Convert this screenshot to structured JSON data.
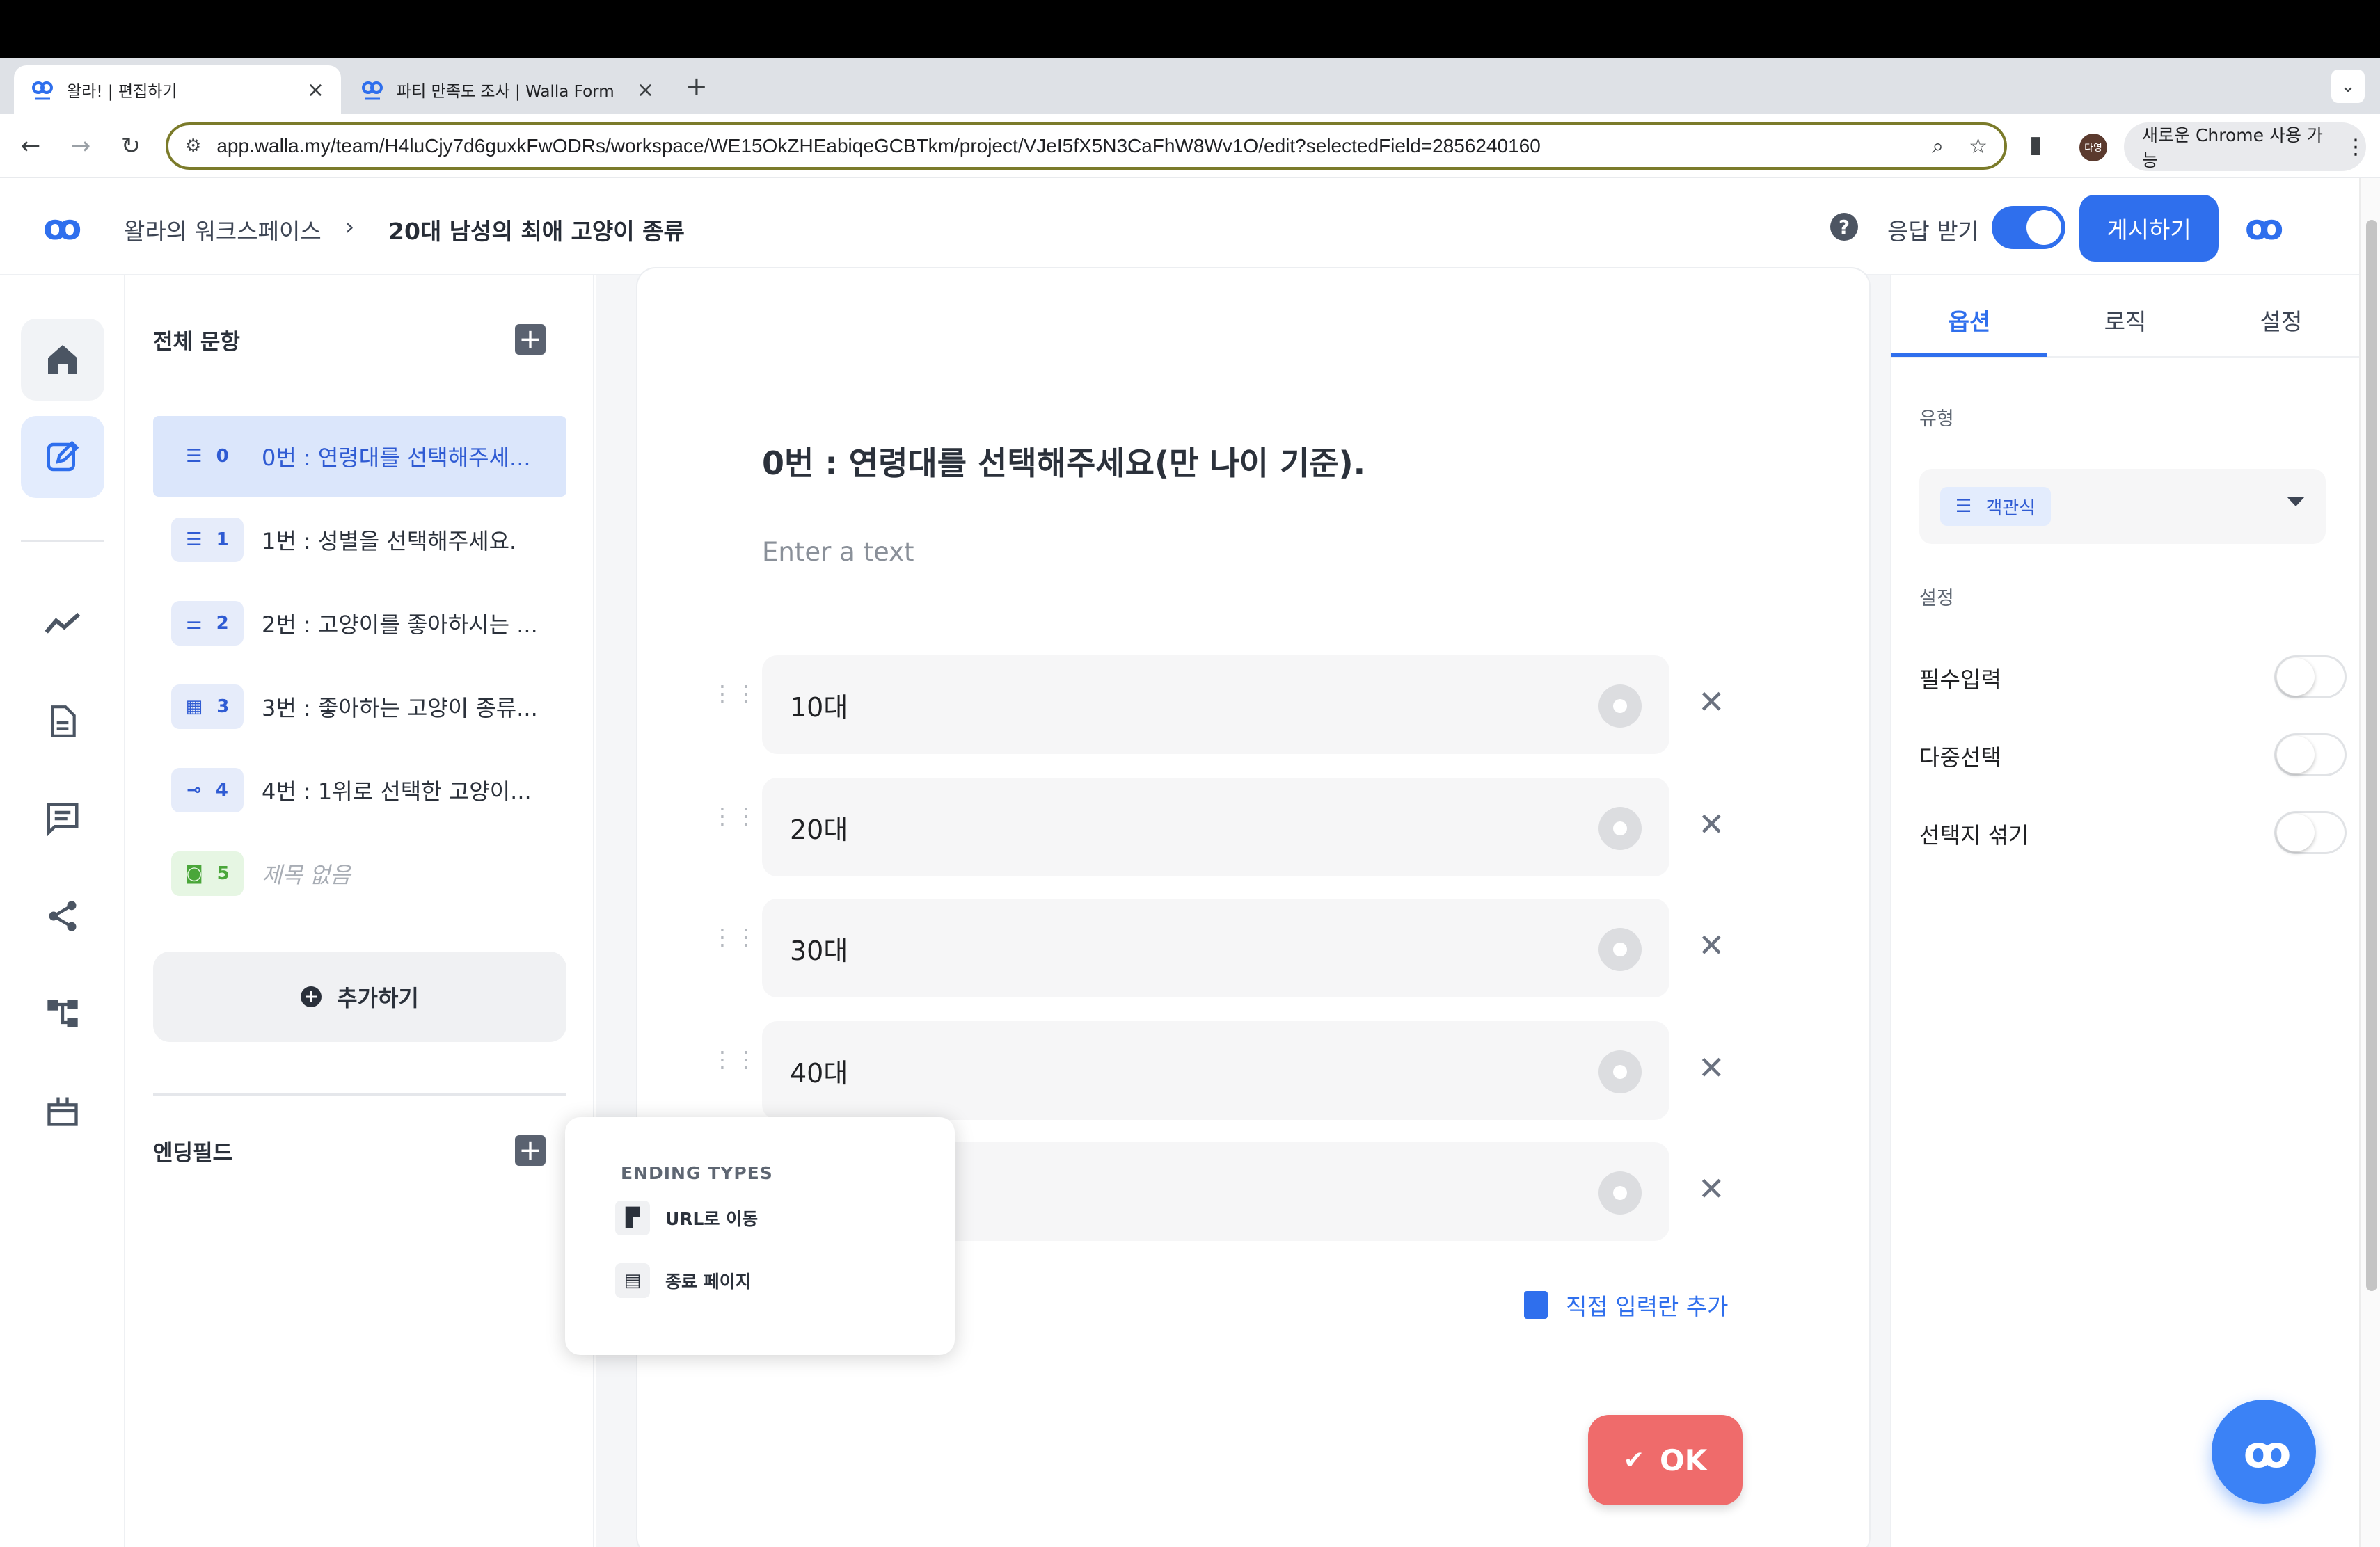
{
  "browser": {
    "tabs": [
      {
        "title": "왈라! | 편집하기",
        "active": true
      },
      {
        "title": "파티 만족도 조사 | Walla Form",
        "active": false
      }
    ],
    "url": "app.walla.my/team/H4luCjy7d6guxkFwODRs/workspace/WE15OkZHEabiqeGCBTkm/project/VJeI5fX5N3CaFhW8Wv1O/edit?selectedField=2856240160",
    "profile_initials": "다영",
    "chrome_pill": "새로운 Chrome 사용 가능"
  },
  "header": {
    "logo": "ꝏ",
    "breadcrumb": [
      "왈라의 워크스페이스",
      "20대 남성의 최애 고양이 종류"
    ],
    "breadcrumb_sep": "›",
    "response_label": "응답 받기",
    "response_on": true,
    "publish_label": "게시하기"
  },
  "sidebar": {
    "all_questions_title": "전체 문항",
    "questions": [
      {
        "index": "0",
        "icon": "list-icon",
        "label": "0번 : 연령대를 선택해주세...",
        "selected": true
      },
      {
        "index": "1",
        "icon": "list-icon",
        "label": "1번 : 성별을 선택해주세요."
      },
      {
        "index": "2",
        "icon": "short-text-icon",
        "label": "2번 : 고양이를 좋아하시는 ..."
      },
      {
        "index": "3",
        "icon": "grid-icon",
        "label": "3번 : 좋아하는 고양이 종류..."
      },
      {
        "index": "4",
        "icon": "ranking-icon",
        "label": "4번 : 1위로 선택한 고양이..."
      },
      {
        "index": "5",
        "icon": "camera-icon",
        "label": "제목 없음",
        "untitled": true
      }
    ],
    "add_label": "추가하기",
    "ending_title": "엔딩필드"
  },
  "editor": {
    "question_title": "0번 : 연령대를 선택해주세요(만 나이 기준).",
    "description_placeholder": "Enter a text",
    "choices": [
      "10대",
      "20대",
      "30대",
      "40대",
      ""
    ],
    "add_input_label": "직접 입력란 추가",
    "ok_label": "OK",
    "ok_color": "#ef6b6b"
  },
  "ending_popover": {
    "title": "ENDING TYPES",
    "items": [
      {
        "icon": "door-icon",
        "label": "URL로 이동"
      },
      {
        "icon": "clipboard-icon",
        "label": "종료 페이지"
      }
    ]
  },
  "right_panel": {
    "tabs": [
      "옵션",
      "로직",
      "설정"
    ],
    "active_tab": "옵션",
    "type_label": "유형",
    "type_value": "객관식",
    "settings_label": "설정",
    "toggles": [
      {
        "label": "필수입력",
        "on": false
      },
      {
        "label": "다중선택",
        "on": false
      },
      {
        "label": "선택지 섞기",
        "on": false
      }
    ]
  },
  "colors": {
    "accent": "#2f6fed",
    "ok": "#ef6b6b"
  }
}
